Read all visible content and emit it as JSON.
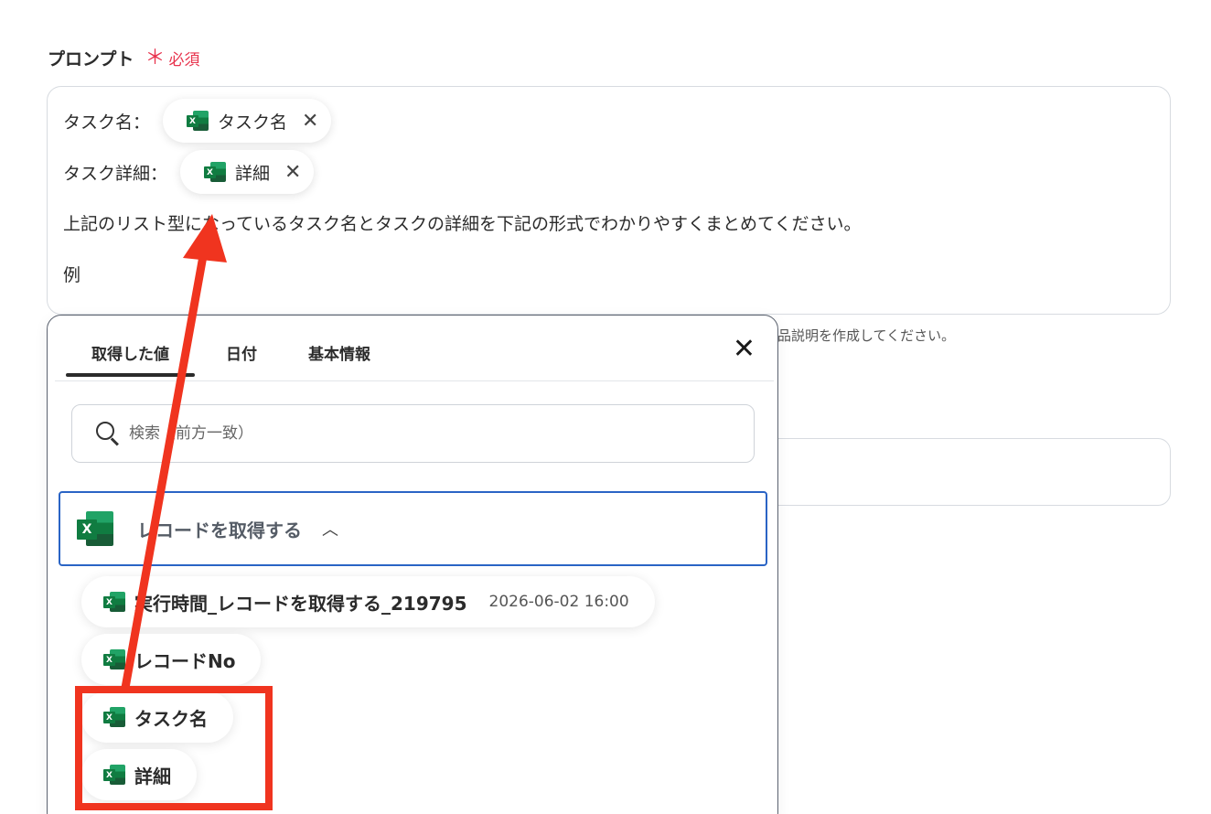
{
  "field": {
    "label": "プロンプト",
    "required_mark": "＊",
    "required_text": "必須"
  },
  "prompt": {
    "line1_label": "タスク名：",
    "chip1": {
      "icon": "excel-icon",
      "text": "タスク名"
    },
    "line2_label": "タスク詳細：",
    "chip2": {
      "icon": "excel-icon",
      "text": "詳細"
    },
    "body_text": "上記のリスト型になっているタスク名とタスクの詳細を下記の形式でわかりやすくまとめてください。",
    "example_text": "例"
  },
  "hint_text": "品説明を作成してください。",
  "panel": {
    "tabs": [
      {
        "label": "取得した値"
      },
      {
        "label": "日付"
      },
      {
        "label": "基本情報"
      }
    ],
    "close_icon": "close-icon",
    "search_placeholder": "検索（前方一致）",
    "section": {
      "title": "レコードを取得する",
      "icon": "excel-icon",
      "chevron": "chevron-up-icon"
    },
    "items": [
      {
        "label": "実行時間_レコードを取得する_219795",
        "value": "2026-06-02 16:00"
      },
      {
        "label": "レコードNo"
      },
      {
        "label": "タスク名"
      },
      {
        "label": "詳細"
      }
    ]
  },
  "colors": {
    "accent_blue": "#2a64c5",
    "required_red": "#e8344e",
    "highlight_red": "#f0341f",
    "excel_green": "#107c41"
  }
}
